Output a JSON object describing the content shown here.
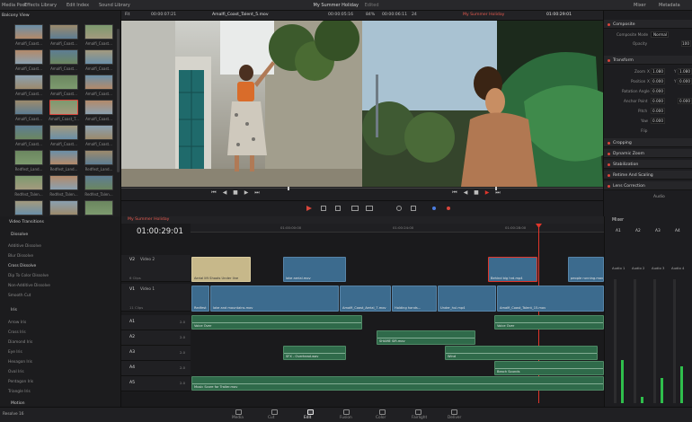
{
  "topbar": {
    "media_pool_tab": "Media Pool",
    "effects_tab": "Effects Library",
    "edit_index_tab": "Edit Index",
    "sound_library_tab": "Sound Library",
    "project_title": "My Summer Holiday",
    "edited_label": "Edited",
    "mixer_tab": "Mixer",
    "metadata_tab": "Metadata"
  },
  "source_viewer": {
    "fit": "Fit",
    "timecode_left": "00:00:07:21",
    "clip_name": "Amalfi_Coast_Talent_5.mov",
    "timecode_right": "00:00:05:16"
  },
  "timeline_viewer": {
    "zoom": "84%",
    "timecode_left": "00:00:06:11",
    "fps": "24",
    "timeline_name": "My Summer Holiday",
    "timecode_right": "01:00:29:01"
  },
  "media_pool": {
    "view_label": "Balcony View",
    "clips": [
      "Amalfi_Coast...",
      "Amalfi_Coast...",
      "Amalfi_Coast...",
      "Amalfi_Coast...",
      "Amalfi_Coast...",
      "Amalfi_Coast...",
      "Amalfi_Coast...",
      "Amalfi_Coast...",
      "Amalfi_Coast...",
      "Amalfi_Coast...",
      "Amalfi_Coast_T...",
      "Amalfi_Coast...",
      "Amalfi_Coast...",
      "Amalfi_Coast...",
      "Amalfi_Coast...",
      "Redfest_Land...",
      "Redfest_Land...",
      "Redfest_Land...",
      "Redfest_Talen...",
      "Redfest_Talen...",
      "Redfest_Talen...",
      "Redfest_Talen...",
      "Redfest_Talen...",
      "Redfest_Talen..."
    ]
  },
  "inspector": {
    "composite": {
      "title": "Composite",
      "mode_label": "Composite Mode",
      "mode_value": "Normal",
      "opacity_label": "Opacity",
      "opacity_value": "100"
    },
    "transform": {
      "title": "Transform",
      "zoom_label": "Zoom",
      "zoom_x": "1.080",
      "zoom_y": "1.080",
      "position_label": "Position",
      "pos_x": "0.000",
      "pos_y": "0.000",
      "rotation_label": "Rotation Angle",
      "rotation_value": "0.000",
      "anchor_label": "Anchor Point",
      "anchor_x": "0.000",
      "anchor_y": "0.000",
      "pitch_label": "Pitch",
      "pitch_value": "0.000",
      "yaw_label": "Yaw",
      "yaw_value": "0.000",
      "flip_label": "Flip"
    },
    "sections": [
      "Cropping",
      "Dynamic Zoom",
      "Stabilization",
      "Retime And Scaling",
      "Lens Correction"
    ],
    "audio_label": "Audio"
  },
  "effects": {
    "header": "Video Transitions",
    "dissolve_header": "Dissolve",
    "dissolve_items": [
      "Additive Dissolve",
      "Blur Dissolve",
      "Cross Dissolve",
      "Dip To Color Dissolve",
      "Non-Additive Dissolve",
      "Smooth Cut"
    ],
    "iris_header": "Iris",
    "iris_items": [
      "Arrow Iris",
      "Cross Iris",
      "Diamond Iris",
      "Eye Iris",
      "Hexagon Iris",
      "Oval Iris",
      "Pentagon Iris",
      "Triangle Iris"
    ],
    "motion_header": "Motion"
  },
  "timeline": {
    "tab_name": "My Summer Holiday",
    "timecode": "01:00:29:01",
    "ruler": [
      "01:00:00:00",
      "01:00:24:00",
      "01:00:28:00"
    ],
    "tracks": {
      "v2": {
        "id": "V2",
        "name": "Video 2",
        "clips_count": "6 Clips"
      },
      "v1": {
        "id": "V1",
        "name": "Video 1",
        "clips_count": "11 Clips"
      },
      "a1": {
        "id": "A1",
        "level": "2.0"
      },
      "a2": {
        "id": "A2",
        "level": "2.0"
      },
      "a3": {
        "id": "A3",
        "level": "2.0"
      },
      "a4": {
        "id": "A4",
        "level": "2.0"
      },
      "a5": {
        "id": "A5",
        "level": "2.0"
      }
    },
    "clips": {
      "v2_a": "Aerial lift Shoots Under line",
      "v2_b": "lake aerial.mov",
      "v2_c": "Behind big hrd.mp4",
      "v2_d": "people running.mov",
      "v1_a": "Redfest",
      "v1_b": "lake and mountains.mov",
      "v1_c": "Amalfi_Coast_Aerial_7.mov",
      "v1_d": "Holding hands...",
      "v1_e": "Under_hul.mp4",
      "v1_f": "Amalfi_Coast_Talent_15.mov",
      "a1_a": "Voice Over",
      "a1_b": "Voice Over",
      "a2_a": "SHAME SIR.mov",
      "a3_a": "SFX - Overhead.wav",
      "a3_b": "Wind",
      "a4_a": "Beach Sounds",
      "a5_a": "Music Score for Trailer.mov"
    }
  },
  "mixer": {
    "title": "Mixer",
    "channels": [
      "A1",
      "A2",
      "A3",
      "A4"
    ],
    "buses": [
      "Audio 1",
      "Audio 2",
      "Audio 3",
      "Audio 4"
    ]
  },
  "pages": {
    "items": [
      "Media",
      "Cut",
      "Edit",
      "Fusion",
      "Color",
      "Fairlight",
      "Deliver"
    ],
    "active": "Edit",
    "app_name": "Resolve 16"
  },
  "colors": {
    "accent_red": "#d9463b",
    "video_clip": "#3c6b8e",
    "audio_clip": "#2f6a4a",
    "playhead": "#e0362b"
  }
}
